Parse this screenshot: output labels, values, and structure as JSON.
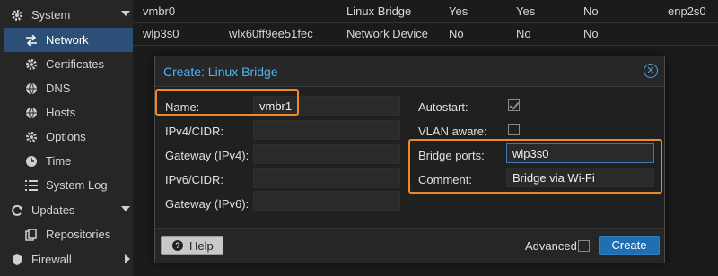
{
  "sidebar": {
    "items": [
      {
        "label": "System",
        "icon": "gear-icon",
        "caret": "down"
      },
      {
        "label": "Network",
        "icon": "network-icon",
        "active": true
      },
      {
        "label": "Certificates",
        "icon": "certificate-icon"
      },
      {
        "label": "DNS",
        "icon": "globe-icon"
      },
      {
        "label": "Hosts",
        "icon": "globe-icon"
      },
      {
        "label": "Options",
        "icon": "gear-icon"
      },
      {
        "label": "Time",
        "icon": "clock-icon"
      },
      {
        "label": "System Log",
        "icon": "list-icon"
      },
      {
        "label": "Updates",
        "icon": "refresh-icon",
        "caret": "down"
      },
      {
        "label": "Repositories",
        "icon": "repository-icon"
      },
      {
        "label": "Firewall",
        "icon": "shield-icon",
        "caret": "right"
      }
    ]
  },
  "table": {
    "rows": [
      [
        "vmbr0",
        "",
        "Linux Bridge",
        "Yes",
        "Yes",
        "No",
        "enp2s0"
      ],
      [
        "wlp3s0",
        "wlx60ff9ee51fec",
        "Network Device",
        "No",
        "No",
        "No",
        ""
      ]
    ]
  },
  "dialog": {
    "title": "Create: Linux Bridge",
    "left": {
      "name_label": "Name:",
      "name_value": "vmbr1",
      "ipv4_label": "IPv4/CIDR:",
      "ipv4_value": "",
      "gw4_label": "Gateway (IPv4):",
      "gw4_value": "",
      "ipv6_label": "IPv6/CIDR:",
      "ipv6_value": "",
      "gw6_label": "Gateway (IPv6):",
      "gw6_value": ""
    },
    "right": {
      "autostart_label": "Autostart:",
      "autostart_checked": true,
      "vlan_label": "VLAN aware:",
      "vlan_checked": false,
      "ports_label": "Bridge ports:",
      "ports_value": "wlp3s0",
      "comment_label": "Comment:",
      "comment_value": "Bridge via Wi-Fi"
    },
    "footer": {
      "help_label": "Help",
      "advanced_label": "Advanced",
      "advanced_checked": false,
      "create_label": "Create"
    }
  },
  "colors": {
    "title": "#4fb3f2",
    "highlight": "#ec8a2a",
    "primary_button": "#1f6fb2",
    "active_nav": "#2b4f77"
  }
}
